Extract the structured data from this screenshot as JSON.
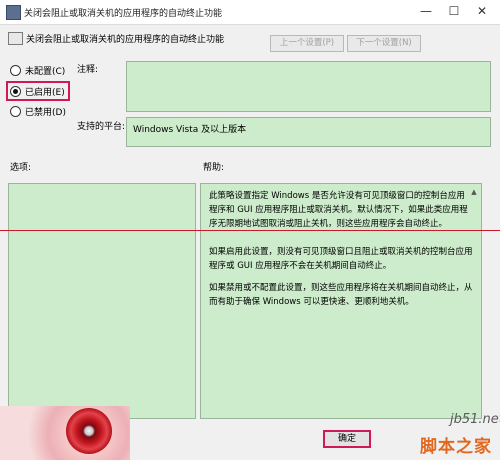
{
  "window": {
    "title": "关闭会阻止或取消关机的应用程序的自动终止功能",
    "minimize_glyph": "—",
    "maximize_glyph": "☐",
    "close_glyph": "✕"
  },
  "header": {
    "policy_name": "关闭会阻止或取消关机的应用程序的自动终止功能",
    "prev_setting": "上一个设置(P)",
    "next_setting": "下一个设置(N)"
  },
  "options": {
    "not_configured": "未配置(C)",
    "enabled": "已启用(E)",
    "disabled": "已禁用(D)",
    "selected": "enabled"
  },
  "comment": {
    "label": "注释:",
    "value": ""
  },
  "platform": {
    "label": "支持的平台:",
    "value": "Windows Vista 及以上版本"
  },
  "options_section": {
    "label": "选项:"
  },
  "help_section": {
    "label": "帮助:",
    "paragraphs": [
      "此策略设置指定 Windows 是否允许没有可见顶级窗口的控制台应用程序和 GUI 应用程序阻止或取消关机。默认情况下，如果此类应用程序无限期地试图取消或阻止关机，则这些应用程序会自动终止。",
      "如果启用此设置，则没有可见顶级窗口且阻止或取消关机的控制台应用程序或 GUI 应用程序不会在关机期间自动终止。",
      "如果禁用或不配置此设置，则这些应用程序将在关机期间自动终止，从而有助于确保 Windows 可以更快速、更顺利地关机。"
    ]
  },
  "footer": {
    "ok_label": "确定"
  },
  "watermark": {
    "site": "jb51.net",
    "name": "脚本之家"
  },
  "colors": {
    "panel_green": "#cdeccb",
    "highlight": "#d1185a",
    "divider_red": "#c8192a"
  }
}
